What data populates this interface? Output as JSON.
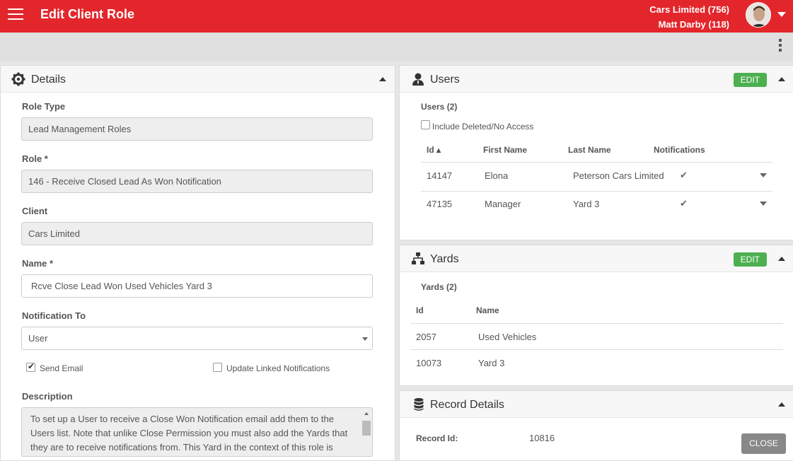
{
  "header": {
    "title": "Edit Client Role",
    "account_line1": "Cars Limited (756)",
    "account_line2": "Matt Darby (118)",
    "brand_color": "#e3262b"
  },
  "details": {
    "title": "Details",
    "role_type_label": "Role Type",
    "role_type_value": "Lead Management Roles",
    "role_label": "Role *",
    "role_value": "146 - Receive Closed Lead As Won Notification",
    "client_label": "Client",
    "client_value": "Cars Limited",
    "name_label": "Name *",
    "name_value": "Rcve Close Lead  Won  Used Vehicles Yard 3",
    "notification_label": "Notification To",
    "notification_value": "User",
    "send_email_label": "Send Email",
    "send_email_checked": true,
    "update_linked_label": "Update Linked Notifications",
    "update_linked_checked": false,
    "description_label": "Description",
    "description_text": "To set up a User to receive a Close Won Notification email add them to the Users list.  Note that unlike Close Permission you must also add the Yards that they are to receive notifications from.  This Yard in the context of this role is"
  },
  "users": {
    "title": "Users",
    "edit_label": "EDIT",
    "count_label": "Users (2)",
    "include_deleted_label": "Include Deleted/No Access",
    "columns": [
      "Id ▴",
      "First Name",
      "Last Name",
      "Notifications"
    ],
    "rows": [
      {
        "id": "14147",
        "first": "Elona",
        "last": "Peterson Cars Limited"
      },
      {
        "id": "47135",
        "first": "Manager",
        "last": "Yard 3"
      }
    ]
  },
  "yards": {
    "title": "Yards",
    "edit_label": "EDIT",
    "count_label": "Yards (2)",
    "columns": [
      "Id",
      "Name"
    ],
    "rows": [
      {
        "id": "2057",
        "name": "Used Vehicles"
      },
      {
        "id": "10073",
        "name": "Yard 3"
      }
    ]
  },
  "record": {
    "title": "Record Details",
    "id_label": "Record Id:",
    "id_value": "10816",
    "close_label": "CLOSE"
  },
  "icons": {
    "menu": "hamburger-menu-icon",
    "details": "gear-icon",
    "users": "user-icon",
    "yards": "sitemap-icon",
    "record": "database-icon",
    "more": "kebab-menu-icon"
  }
}
